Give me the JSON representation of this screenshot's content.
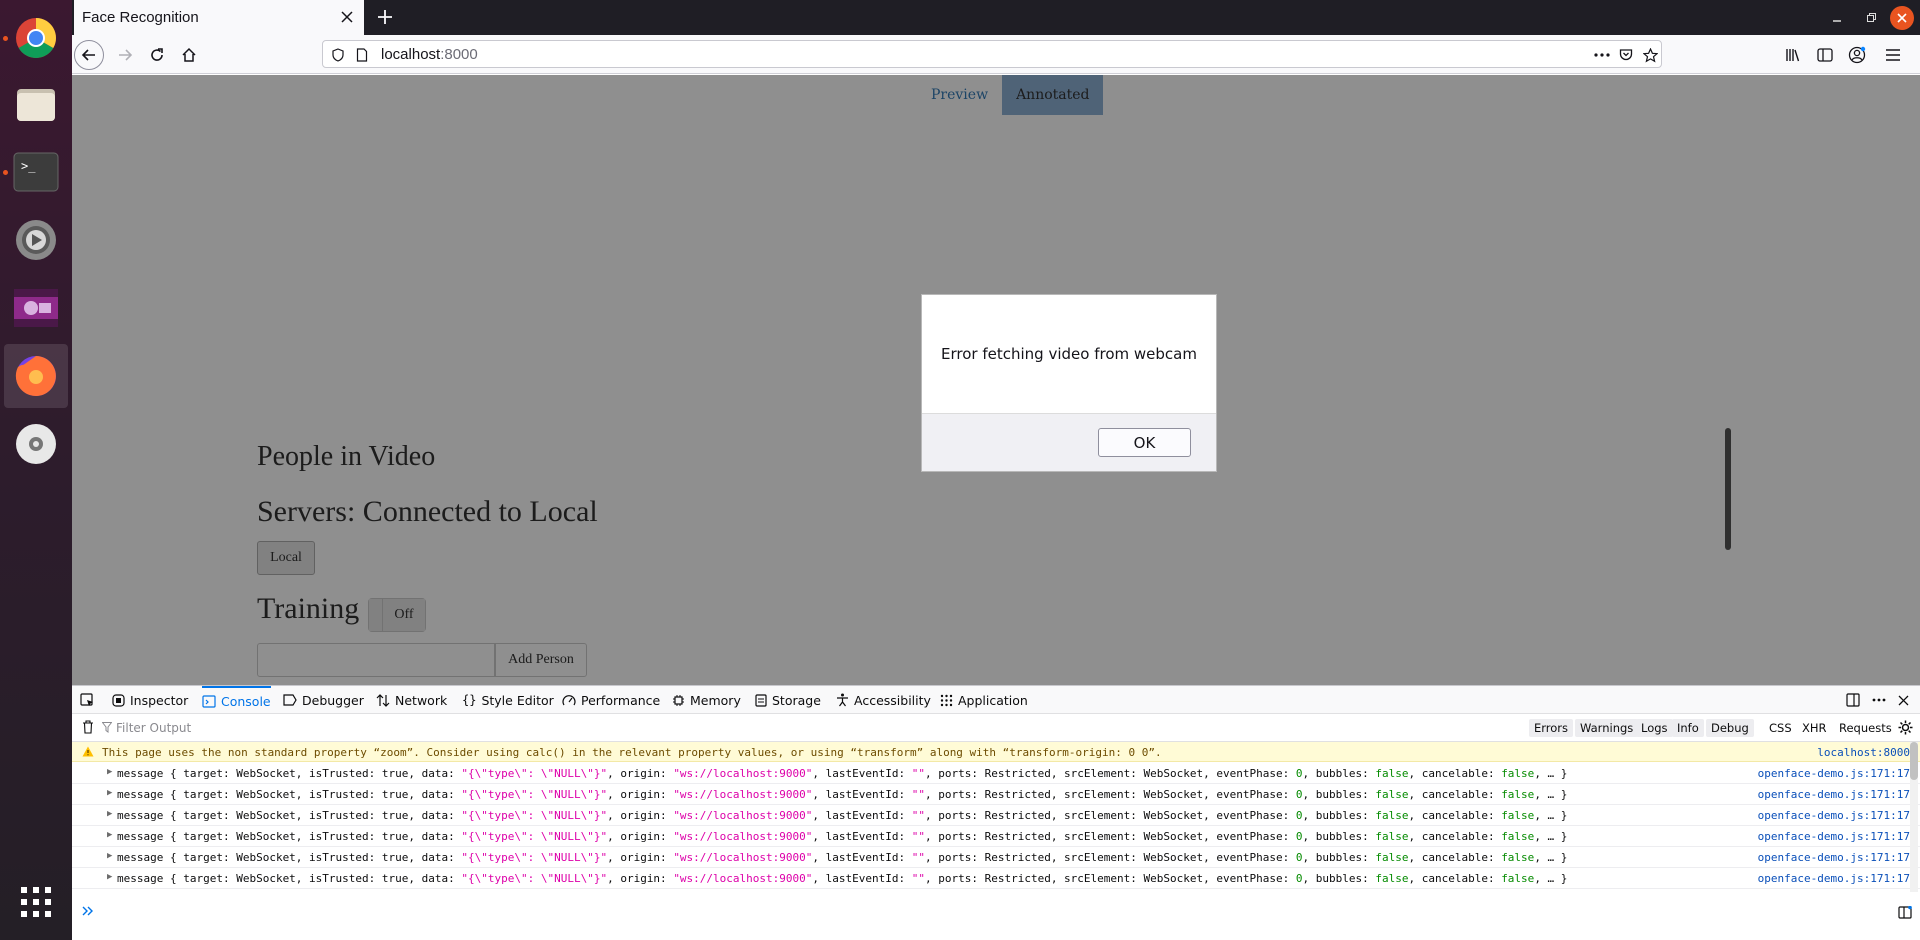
{
  "dock": {
    "items": [
      "chrome-icon",
      "files-icon",
      "terminal-icon",
      "settings-icon",
      "video-icon",
      "firefox-icon",
      "disc-icon",
      "app-grid-icon"
    ]
  },
  "browser": {
    "tab_title": "Face Recognition",
    "url_host": "localhost",
    "url_port": ":8000"
  },
  "page": {
    "view_tabs": [
      "Preview",
      "Annotated"
    ],
    "people_heading": "People in Video",
    "servers_heading": "Servers: Connected to Local",
    "local_button": "Local",
    "training_heading": "Training",
    "training_toggle": "Off",
    "add_person_button": "Add Person"
  },
  "dialog": {
    "message": "Error fetching video from webcam",
    "ok_label": "OK"
  },
  "devtools": {
    "tabs": [
      "Inspector",
      "Console",
      "Debugger",
      "Network",
      "Style Editor",
      "Performance",
      "Memory",
      "Storage",
      "Accessibility",
      "Application"
    ],
    "filter_placeholder": "Filter Output",
    "filters": [
      "Errors",
      "Warnings",
      "Logs",
      "Info",
      "Debug"
    ],
    "filters_extra": [
      "CSS",
      "XHR",
      "Requests"
    ],
    "warning": {
      "text": "This page uses the non standard property “zoom”. Consider using calc() in the relevant property values, or using “transform” along with “transform-origin: 0 0”.",
      "source": "localhost:8000"
    },
    "log_source": "openface-demo.js:171:17",
    "log_count": 6,
    "log_parts": {
      "prefix": "message { target: WebSocket, isTrusted: true, data: ",
      "data": "\"{\\\"type\\\": \\\"NULL\\\"}\"",
      "mid1": ", origin: ",
      "origin": "\"ws://localhost:9000\"",
      "mid2": ", lastEventId: ",
      "lastEventId": "\"\"",
      "mid3": ", ports: Restricted, srcElement: WebSocket, eventPhase: ",
      "eventPhase": "0",
      "mid4": ", bubbles: ",
      "bubbles": "false",
      "mid5": ", cancelable: ",
      "cancelable": "false",
      "suffix": ", … }"
    }
  }
}
